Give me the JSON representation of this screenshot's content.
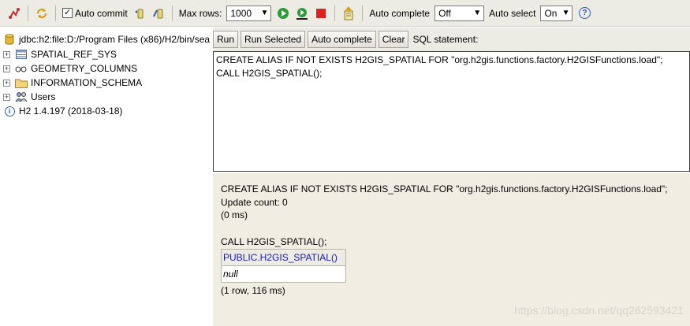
{
  "toolbar": {
    "auto_commit_label": "Auto commit",
    "auto_commit_checked": true,
    "max_rows_label": "Max rows:",
    "max_rows_value": "1000",
    "auto_complete_label": "Auto complete",
    "auto_complete_value": "Off",
    "auto_select_label": "Auto select",
    "auto_select_value": "On",
    "help_glyph": "?"
  },
  "tree": {
    "connection": "jdbc:h2:file:D:/Program Files (x86)/H2/bin/sea",
    "items": [
      {
        "label": "SPATIAL_REF_SYS",
        "icon": "table-icon"
      },
      {
        "label": "GEOMETRY_COLUMNS",
        "icon": "view-icon"
      },
      {
        "label": "INFORMATION_SCHEMA",
        "icon": "folder-icon"
      },
      {
        "label": "Users",
        "icon": "users-icon"
      }
    ],
    "version": "H2 1.4.197 (2018-03-18)"
  },
  "query": {
    "run_label": "Run",
    "run_selected_label": "Run Selected",
    "auto_complete_label": "Auto complete",
    "clear_label": "Clear",
    "sql_statement_label": "SQL statement:",
    "sql_line1": "CREATE ALIAS IF NOT EXISTS H2GIS_SPATIAL FOR \"org.h2gis.functions.factory.H2GISFunctions.load\";",
    "sql_line2": "CALL H2GIS_SPATIAL();"
  },
  "results": {
    "stmt1": "CREATE ALIAS IF NOT EXISTS H2GIS_SPATIAL FOR \"org.h2gis.functions.factory.H2GISFunctions.load\";",
    "update_count": "Update count: 0",
    "time1": "(0 ms)",
    "stmt2": "CALL H2GIS_SPATIAL();",
    "column_header": "PUBLIC.H2GIS_SPATIAL()",
    "cell_value": "null",
    "summary": "(1 row, 116 ms)"
  },
  "watermark": "https://blog.csdn.net/qq262593421"
}
